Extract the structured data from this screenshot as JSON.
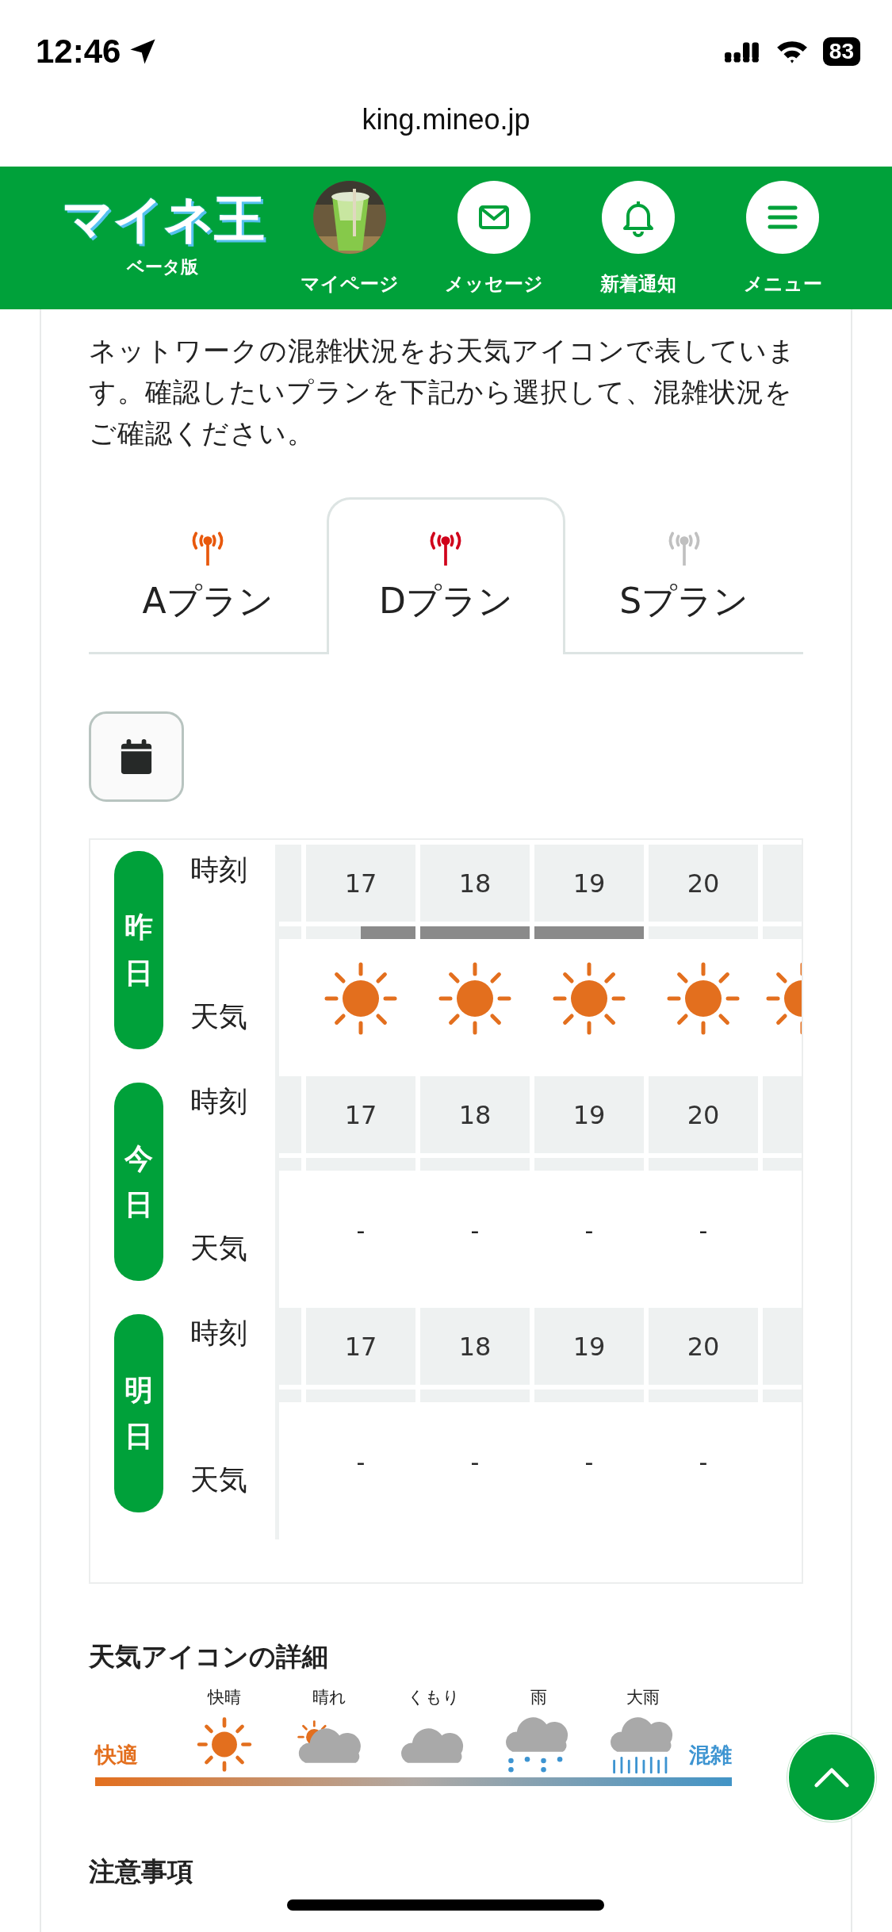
{
  "status_bar": {
    "time": "12:46",
    "battery": "83"
  },
  "browser": {
    "url": "king.mineo.jp"
  },
  "header": {
    "logo": "マイネ王",
    "logo_sub": "ベータ版",
    "nav": [
      {
        "kind": "avatar",
        "label": "マイページ"
      },
      {
        "kind": "mail",
        "label": "メッセージ"
      },
      {
        "kind": "bell",
        "label": "新着通知"
      },
      {
        "kind": "menu",
        "label": "メニュー"
      }
    ]
  },
  "intro": "ネットワークの混雑状況をお天気アイコンで表しています。確認したいプランを下記から選択して、混雑状況をご確認ください。",
  "tabs": [
    {
      "label": "Aプラン",
      "color": "#e8580c",
      "selected": false
    },
    {
      "label": "Dプラン",
      "color": "#d0021b",
      "selected": true
    },
    {
      "label": "Sプラン",
      "color": "#c0c0c0",
      "selected": false
    }
  ],
  "table": {
    "days": [
      {
        "label": "昨日",
        "hour_label": "時刻",
        "weather_label": "天気",
        "slots": [
          {
            "hour": "17",
            "bar": true,
            "partial": true,
            "kind": "sunny"
          },
          {
            "hour": "18",
            "bar": true,
            "partial": false,
            "kind": "sunny"
          },
          {
            "hour": "19",
            "bar": true,
            "partial": false,
            "kind": "sunny"
          },
          {
            "hour": "20",
            "bar": false,
            "kind": "sunny"
          },
          {
            "kind": "sunny"
          }
        ]
      },
      {
        "label": "今日",
        "hour_label": "時刻",
        "weather_label": "天気",
        "slots": [
          {
            "hour": "17",
            "kind": "dash",
            "text": "-"
          },
          {
            "hour": "18",
            "kind": "dash",
            "text": "-"
          },
          {
            "hour": "19",
            "kind": "dash",
            "text": "-"
          },
          {
            "hour": "20",
            "kind": "dash",
            "text": "-"
          },
          {
            "kind": "empty"
          }
        ]
      },
      {
        "label": "明日",
        "hour_label": "時刻",
        "weather_label": "天気",
        "slots": [
          {
            "hour": "17",
            "kind": "dash",
            "text": "-"
          },
          {
            "hour": "18",
            "kind": "dash",
            "text": "-"
          },
          {
            "hour": "19",
            "kind": "dash",
            "text": "-"
          },
          {
            "hour": "20",
            "kind": "dash",
            "text": "-"
          },
          {
            "kind": "empty"
          }
        ]
      }
    ]
  },
  "legend": {
    "title": "天気アイコンの詳細",
    "items": [
      {
        "kind": "clear",
        "label": "快晴"
      },
      {
        "kind": "sun_cloud",
        "label": "晴れ"
      },
      {
        "kind": "cloudy",
        "label": "くもり"
      },
      {
        "kind": "rain",
        "label": "雨"
      },
      {
        "kind": "heavy_rain",
        "label": "大雨"
      }
    ],
    "low": "快適",
    "high": "混雑"
  },
  "notes_title": "注意事項"
}
